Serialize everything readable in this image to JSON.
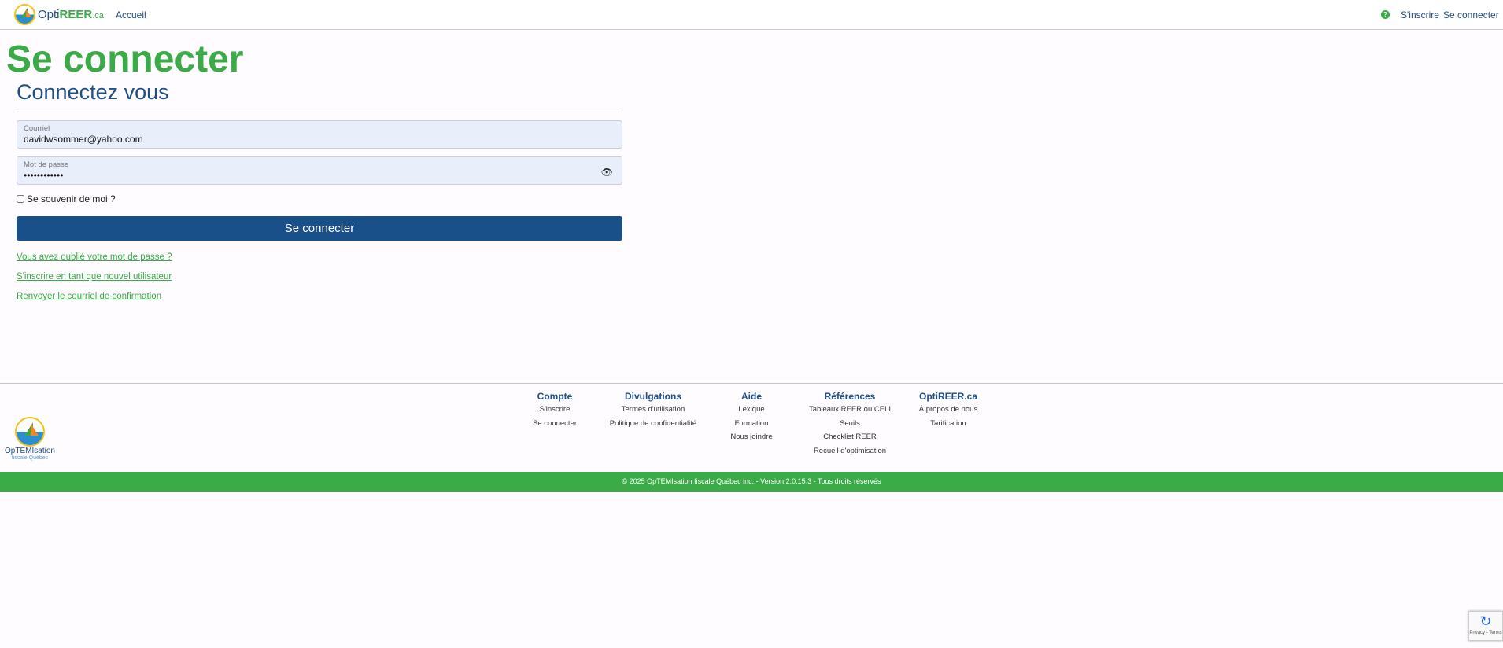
{
  "header": {
    "logo": {
      "opti": "Opti",
      "reer": "REER",
      "ca": ".ca"
    },
    "home": "Accueil",
    "help_icon": "?",
    "register": "S'inscrire",
    "login": "Se connecter"
  },
  "main": {
    "title": "Se connecter",
    "subtitle": "Connectez vous",
    "email": {
      "label": "Courriel",
      "value": "davidwsommer@yahoo.com"
    },
    "password": {
      "label": "Mot de passe",
      "value": "••••••••••••",
      "toggle_icon": "eye-icon"
    },
    "remember": "Se souvenir de moi ?",
    "submit": "Se connecter",
    "links": [
      "Vous avez oublié votre mot de passe ?",
      "S'inscrire en tant que nouvel utilisateur",
      "Renvoyer le courriel de confirmation"
    ]
  },
  "footer": {
    "logo": {
      "name": "OpTEMIsation",
      "tag": "fiscale Québec"
    },
    "columns": [
      {
        "title": "Compte",
        "items": [
          "S'inscrire",
          "Se connecter"
        ]
      },
      {
        "title": "Divulgations",
        "items": [
          "Termes d'utilisation",
          "Politique de confidentialité"
        ]
      },
      {
        "title": "Aide",
        "items": [
          "Lexique",
          "Formation",
          "Nous joindre"
        ]
      },
      {
        "title": "Références",
        "items": [
          "Tableaux REER ou CELI",
          "Seuils",
          "Checklist REER",
          "Recueil d'optimisation"
        ]
      },
      {
        "title": "OptiREER.ca",
        "items": [
          "À propos de nous",
          "Tarification"
        ]
      }
    ],
    "copyright": "© 2025 OpTEMIsation fiscale Québec inc. - Version 2.0.15.3 - Tous droits réservés"
  },
  "captcha": {
    "text": "Privacy - Terms"
  },
  "colors": {
    "green": "#3aab47",
    "blue": "#1a5089"
  }
}
